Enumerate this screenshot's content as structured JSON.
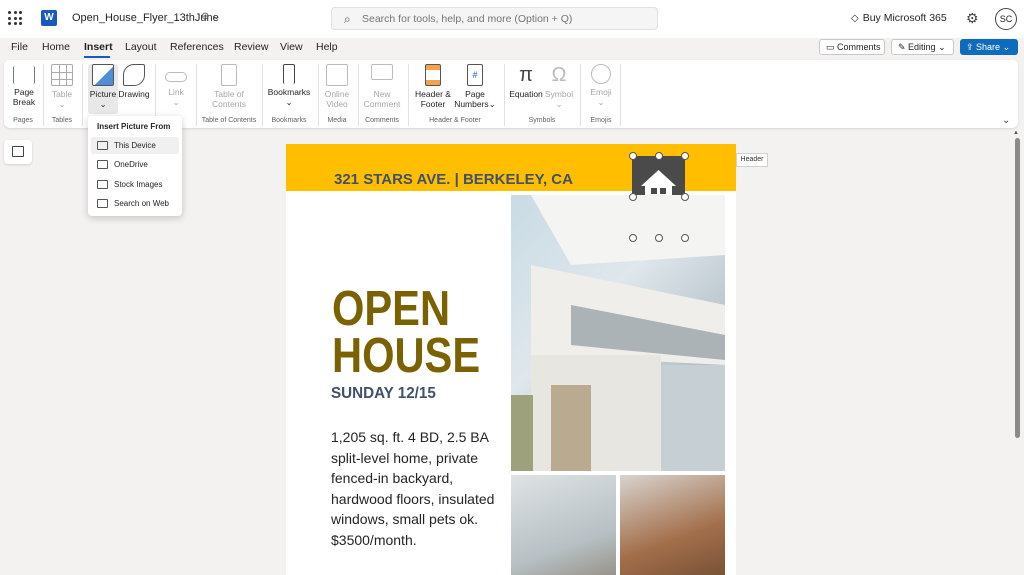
{
  "titlebar": {
    "app_icon": "W",
    "doc_title": "Open_House_Flyer_13thJune",
    "search_placeholder": "Search for tools, help, and more (Option + Q)",
    "buy_label": "Buy Microsoft 365",
    "avatar_initials": "SC"
  },
  "menubar": {
    "tabs": [
      "File",
      "Home",
      "Insert",
      "Layout",
      "References",
      "Review",
      "View",
      "Help"
    ],
    "active": "Insert",
    "comments_label": "Comments",
    "editing_label": "Editing",
    "share_label": "Share"
  },
  "ribbon": {
    "buttons": {
      "page_break_1": "Page",
      "page_break_2": "Break",
      "table": "Table",
      "picture": "Picture",
      "drawing": "Drawing",
      "link": "Link",
      "toc_1": "Table of",
      "toc_2": "Contents",
      "bookmarks": "Bookmarks",
      "video_1": "Online",
      "video_2": "Video",
      "comment_1": "New",
      "comment_2": "Comment",
      "hf_1": "Header &",
      "hf_2": "Footer",
      "pn_1": "Page",
      "pn_2": "Numbers",
      "equation": "Equation",
      "symbol": "Symbol",
      "emoji": "Emoji"
    },
    "groups": {
      "pages": "Pages",
      "tables": "Tables",
      "toc": "Table of Contents",
      "bookmarks": "Bookmarks",
      "media": "Media",
      "comments": "Comments",
      "hf": "Header & Footer",
      "symbols": "Symbols",
      "emojis": "Emojis"
    }
  },
  "picture_dropdown": {
    "title": "Insert Picture From",
    "items": [
      "This Device",
      "OneDrive",
      "Stock Images",
      "Search on Web"
    ]
  },
  "document": {
    "address": "321 STARS AVE. | BERKELEY, CA",
    "headline_1": "OPEN",
    "headline_2": "HOUSE",
    "date": "SUNDAY 12/15",
    "description": "1,205 sq. ft. 4 BD, 2.5 BA split-level home, private fenced-in backyard, hardwood floors, insulated windows, small pets ok. $3500/month.",
    "selection_tooltip": "Header"
  },
  "colors": {
    "accent": "#185abd",
    "band": "#ffbf00",
    "headline": "#7a6200",
    "address": "#41506b",
    "share": "#0f6cbd",
    "shield": "#4a4a4a"
  }
}
